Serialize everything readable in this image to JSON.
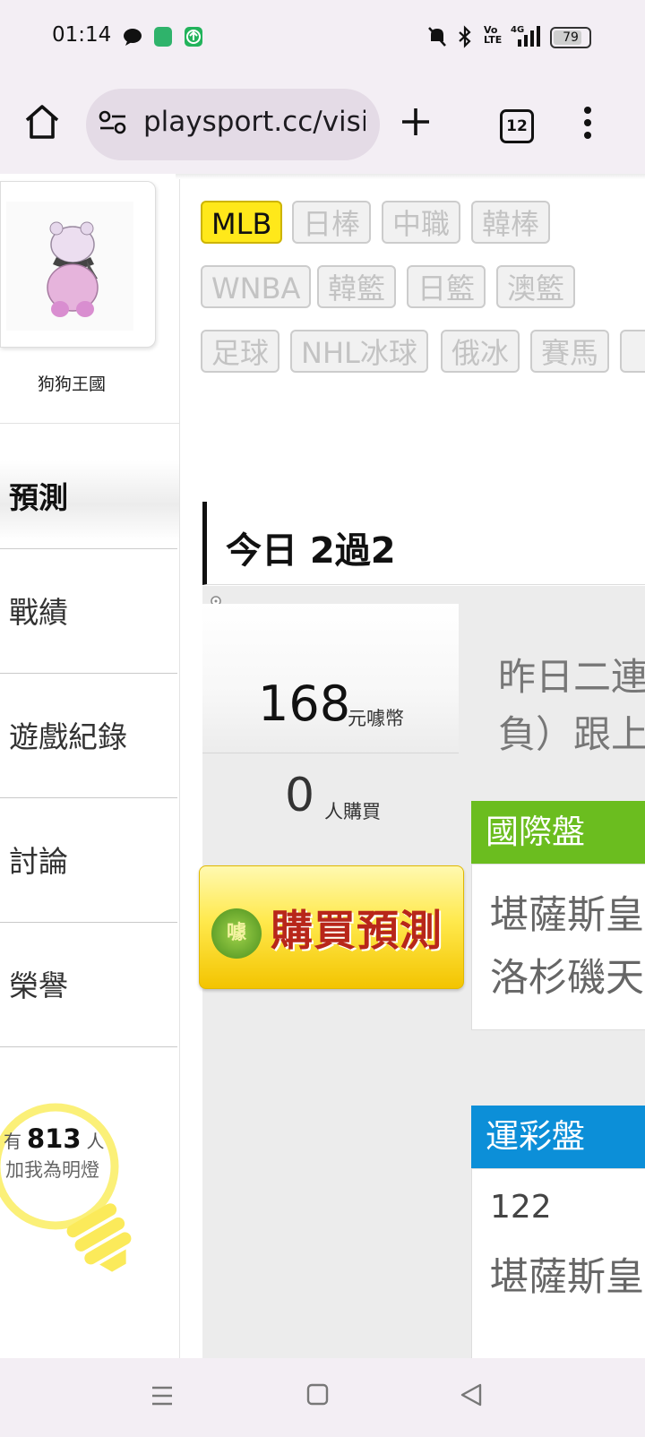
{
  "status_bar": {
    "time": "01:14",
    "battery": "79",
    "icons": [
      "chat-bubble-icon",
      "app-icon",
      "update-icon",
      "mute-icon",
      "bluetooth-icon",
      "volte-icon",
      "signal-4g-icon",
      "battery-icon"
    ]
  },
  "browser": {
    "url": "playsport.cc/visit",
    "tab_count": "12",
    "icons": [
      "home-icon",
      "site-settings-icon",
      "new-tab-icon",
      "more-menu-icon"
    ]
  },
  "left_panel": {
    "avatar_name": "狗狗王國",
    "section_title": "預測",
    "nav_items": [
      "戰績",
      "遊戲紀錄",
      "討論",
      "榮譽"
    ],
    "fans": {
      "prefix": "有",
      "count": "813",
      "suffix": "人",
      "label": "加我為明燈"
    }
  },
  "league_tabs": [
    "MLB",
    "日棒",
    "中職",
    "韓棒",
    "WNBA",
    "韓籃",
    "日籃",
    "澳籃",
    "足球",
    "NHL冰球",
    "俄冰",
    "賽馬",
    ""
  ],
  "active_tab": "MLB",
  "today": {
    "label": "今日 2過2"
  },
  "price": {
    "value": "168",
    "unit": "元噱幣"
  },
  "buyers": {
    "value": "0",
    "unit": "人購買"
  },
  "buy_button": {
    "logo_text": "噱",
    "label": "購買預測"
  },
  "description": {
    "line1": "昨日二連",
    "line2": "負）跟上"
  },
  "international": {
    "title": "國際盤",
    "line1": "堪薩斯皇",
    "line2": "洛杉磯天"
  },
  "lottery": {
    "title": "運彩盤",
    "code": "122",
    "line1": "堪薩斯皇"
  },
  "colors": {
    "accent_yellow": "#ffe81a",
    "international_green": "#6bbd1f",
    "lottery_blue": "#0c8fd8",
    "browser_bg": "#f3eef4"
  }
}
